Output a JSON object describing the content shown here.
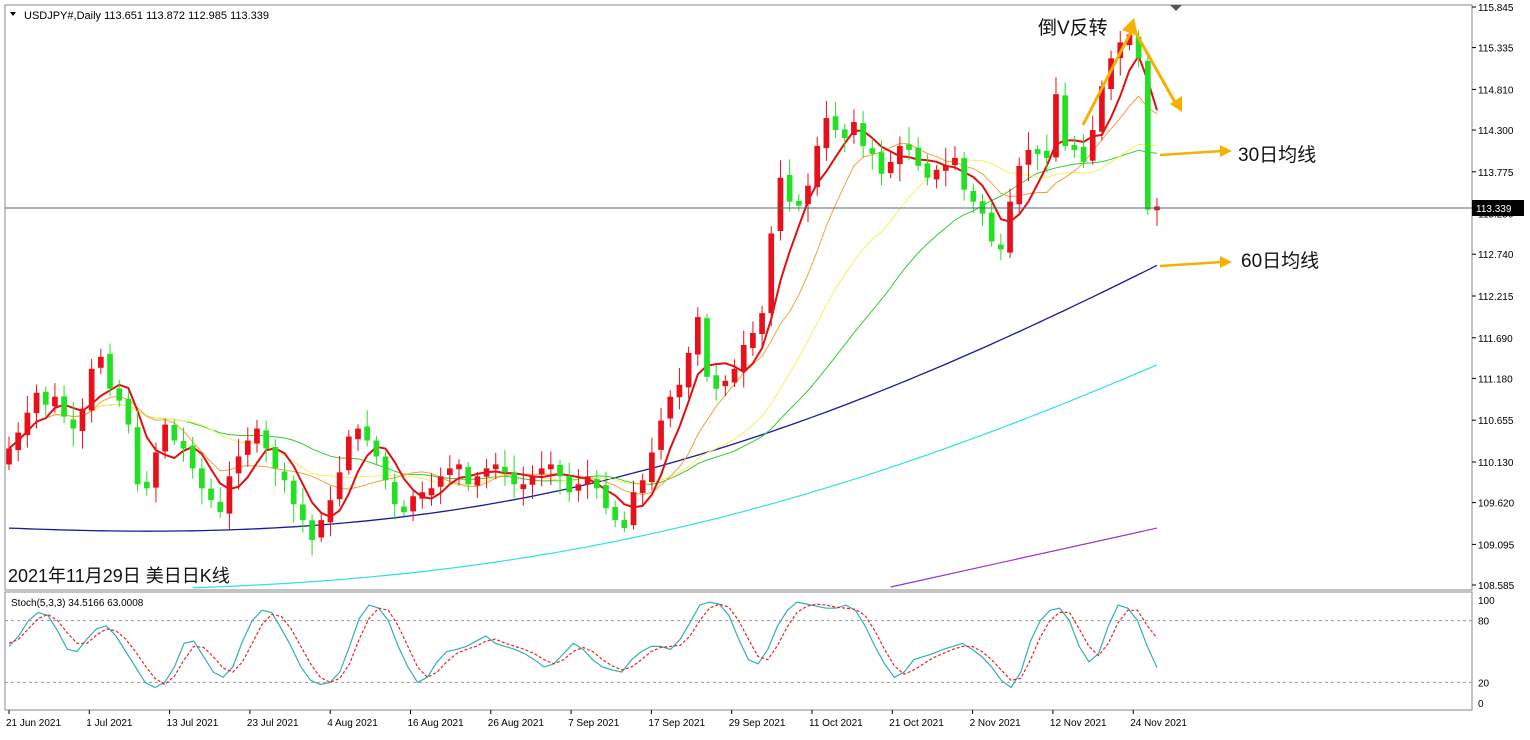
{
  "header": {
    "symbol_line": "USDJPY#,Daily  113.651 113.872 112.985 113.339"
  },
  "annotations": {
    "reversal": "倒V反转",
    "ma30": "30日均线",
    "ma60": "60日均线",
    "caption": "2021年11月29日 美日日K线"
  },
  "colors": {
    "bull": "#e8101a",
    "bear": "#22e022",
    "ma5": "#e01010",
    "ma10": "#f5a040",
    "ma20": "#f5f060",
    "ma30": "#33cc33",
    "ma60": "#1a1a9a",
    "ma120": "#33e0e0",
    "ma250": "#9933cc",
    "arrow": "#f5b000",
    "stoch_k": "#33b0b0",
    "stoch_d": "#ee2222",
    "grid": "#d0d0d0"
  },
  "chart_data": [
    {
      "type": "candlestick",
      "title": "USDJPY#,Daily",
      "ylim": [
        108.585,
        115.845
      ],
      "current_price": "113.339",
      "y_ticks": [
        "115.845",
        "115.335",
        "114.810",
        "114.300",
        "113.775",
        "113.250",
        "112.740",
        "112.215",
        "111.690",
        "111.180",
        "110.655",
        "110.130",
        "109.620",
        "109.095",
        "108.585"
      ],
      "x_labels": [
        "21 Jun 2021",
        "1 Jul 2021",
        "13 Jul 2021",
        "23 Jul 2021",
        "4 Aug 2021",
        "16 Aug 2021",
        "26 Aug 2021",
        "7 Sep 2021",
        "17 Sep 2021",
        "29 Sep 2021",
        "11 Oct 2021",
        "21 Oct 2021",
        "2 Nov 2021",
        "12 Nov 2021",
        "24 Nov 2021"
      ],
      "closes": [
        110.3,
        110.5,
        110.75,
        111.0,
        110.85,
        110.95,
        110.7,
        110.55,
        110.8,
        111.3,
        111.45,
        111.05,
        110.9,
        110.6,
        109.85,
        109.8,
        110.25,
        110.6,
        110.4,
        110.3,
        110.05,
        109.8,
        109.65,
        109.5,
        109.95,
        110.2,
        110.4,
        110.55,
        110.3,
        110.05,
        109.9,
        109.6,
        109.4,
        109.15,
        109.4,
        109.65,
        110.0,
        110.45,
        110.55,
        110.4,
        110.2,
        109.9,
        109.6,
        109.5,
        109.7,
        109.75,
        109.8,
        109.95,
        110.05,
        110.1,
        109.85,
        109.95,
        110.05,
        110.1,
        110.0,
        109.85,
        109.85,
        109.95,
        110.05,
        110.1,
        109.95,
        109.75,
        109.85,
        109.95,
        109.8,
        109.55,
        109.4,
        109.3,
        109.75,
        109.9,
        110.25,
        110.65,
        110.95,
        111.1,
        111.5,
        111.95,
        111.2,
        111.05,
        111.15,
        111.3,
        111.6,
        111.75,
        112.0,
        113.0,
        113.7,
        113.4,
        113.35,
        113.6,
        114.1,
        114.45,
        114.3,
        114.2,
        114.4,
        114.1,
        114.0,
        113.75,
        113.9,
        114.1,
        114.05,
        113.85,
        113.7,
        113.8,
        113.85,
        113.95,
        113.55,
        113.4,
        113.25,
        112.9,
        112.8,
        113.4,
        113.85,
        114.05,
        114.0,
        113.95,
        114.75,
        114.1,
        114.05,
        113.9,
        114.3,
        114.85,
        115.2,
        115.4,
        115.5,
        115.2,
        113.3,
        113.34
      ],
      "ma5_last": 114.55,
      "ma10_last": 114.5,
      "ma20_last": 114.1,
      "ma30_last": 114.0,
      "ma60_last": 112.6,
      "ma120_last": 111.35,
      "ma250_last": 109.3
    },
    {
      "type": "line",
      "title": "Stoch(5,3,3) 34.5166 63.0008",
      "ylim": [
        0,
        100
      ],
      "y_ticks": [
        "100",
        "80",
        "20",
        "0"
      ],
      "levels": [
        80,
        20
      ],
      "series": [
        {
          "name": "34.5166",
          "values": [
            55,
            65,
            80,
            88,
            85,
            70,
            52,
            50,
            62,
            72,
            75,
            65,
            50,
            35,
            20,
            15,
            20,
            35,
            58,
            60,
            45,
            30,
            25,
            35,
            60,
            80,
            90,
            88,
            72,
            55,
            35,
            22,
            18,
            20,
            30,
            55,
            82,
            95,
            92,
            80,
            55,
            35,
            20,
            25,
            40,
            50,
            52,
            55,
            60,
            65,
            58,
            55,
            52,
            48,
            42,
            35,
            38,
            48,
            58,
            52,
            42,
            35,
            32,
            30,
            42,
            50,
            55,
            55,
            52,
            62,
            78,
            95,
            98,
            96,
            85,
            62,
            42,
            38,
            52,
            75,
            90,
            98,
            96,
            94,
            92,
            92,
            95,
            90,
            75,
            55,
            38,
            25,
            30,
            42,
            45,
            48,
            52,
            55,
            58,
            52,
            45,
            35,
            22,
            15,
            30,
            60,
            80,
            90,
            92,
            80,
            55,
            40,
            48,
            75,
            95,
            92,
            80,
            55,
            34.5
          ]
        },
        {
          "name": "63.0008",
          "values": [
            58,
            62,
            72,
            82,
            86,
            80,
            68,
            58,
            58,
            66,
            72,
            70,
            62,
            50,
            36,
            24,
            18,
            26,
            42,
            55,
            54,
            45,
            34,
            30,
            40,
            58,
            76,
            86,
            84,
            72,
            55,
            38,
            25,
            20,
            24,
            38,
            62,
            82,
            92,
            90,
            75,
            55,
            35,
            25,
            30,
            40,
            48,
            52,
            55,
            60,
            62,
            58,
            55,
            52,
            48,
            42,
            38,
            42,
            50,
            54,
            50,
            42,
            36,
            32,
            35,
            42,
            50,
            54,
            55,
            56,
            65,
            80,
            92,
            96,
            93,
            80,
            62,
            45,
            42,
            56,
            74,
            88,
            94,
            96,
            95,
            93,
            92,
            91,
            85,
            70,
            52,
            36,
            28,
            32,
            38,
            44,
            48,
            52,
            55,
            55,
            50,
            42,
            32,
            22,
            24,
            42,
            64,
            80,
            88,
            88,
            72,
            55,
            46,
            58,
            78,
            90,
            90,
            75,
            63
          ]
        }
      ]
    }
  ]
}
